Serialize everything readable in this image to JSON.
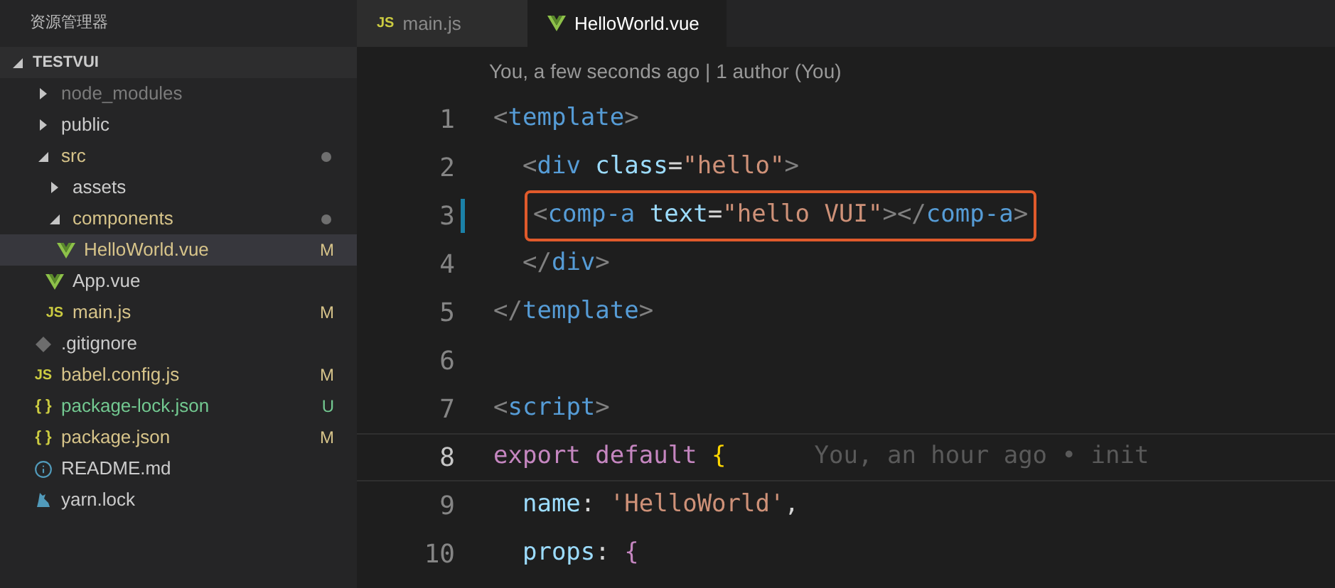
{
  "sidebar": {
    "title": "资源管理器",
    "section": {
      "label": "TESTVUI",
      "expanded": true
    },
    "tree": [
      {
        "name": "node_modules",
        "kind": "folder",
        "expanded": false,
        "color": "#7b7b7b",
        "dot": false,
        "selected": false
      },
      {
        "name": "public",
        "kind": "folder",
        "expanded": false,
        "color": "#cccccc",
        "dot": false,
        "selected": false
      },
      {
        "name": "src",
        "kind": "folder",
        "expanded": true,
        "color": "#d7c48a",
        "dot": true,
        "selected": false,
        "children": [
          {
            "name": "assets",
            "kind": "folder",
            "expanded": false,
            "color": "#cccccc",
            "dot": false,
            "selected": false
          },
          {
            "name": "components",
            "kind": "folder",
            "expanded": true,
            "color": "#d7c48a",
            "dot": true,
            "selected": false,
            "children": [
              {
                "name": "HelloWorld.vue",
                "kind": "vue",
                "color": "#d7c48a",
                "badge": "M",
                "dot": false,
                "selected": true
              }
            ]
          },
          {
            "name": "App.vue",
            "kind": "vue",
            "color": "#cccccc",
            "dot": false,
            "selected": false
          },
          {
            "name": "main.js",
            "kind": "js",
            "icon_label": "JS",
            "color": "#d7c48a",
            "badge": "M",
            "dot": false,
            "selected": false
          }
        ]
      },
      {
        "name": ".gitignore",
        "kind": "git",
        "color": "#cccccc",
        "dot": false,
        "selected": false
      },
      {
        "name": "babel.config.js",
        "kind": "js",
        "icon_label": "JS",
        "color": "#d7c48a",
        "badge": "M",
        "dot": false,
        "selected": false
      },
      {
        "name": "package-lock.json",
        "kind": "json",
        "icon_label": "{ }",
        "color": "#73c991",
        "badge": "U",
        "dot": false,
        "selected": false
      },
      {
        "name": "package.json",
        "kind": "json",
        "icon_label": "{ }",
        "color": "#d7c48a",
        "badge": "M",
        "dot": false,
        "selected": false
      },
      {
        "name": "README.md",
        "kind": "info",
        "color": "#cccccc",
        "dot": false,
        "selected": false
      },
      {
        "name": "yarn.lock",
        "kind": "yarn",
        "color": "#cccccc",
        "dot": false,
        "selected": false
      }
    ]
  },
  "tabs": [
    {
      "label": "main.js",
      "kind": "js",
      "icon_label": "JS",
      "selected": false
    },
    {
      "label": "HelloWorld.vue",
      "kind": "vue",
      "selected": true
    }
  ],
  "editor": {
    "codelens": "You, a few seconds ago | 1 author (You)",
    "lines": [
      {
        "number": "1",
        "active": false,
        "changed": false,
        "tokens": [
          {
            "kind": "punct",
            "text": "<"
          },
          {
            "kind": "tag",
            "text": "template"
          },
          {
            "kind": "punct",
            "text": ">"
          }
        ]
      },
      {
        "number": "2",
        "active": false,
        "changed": false,
        "tokens": [
          {
            "kind": "punct",
            "text": "  <"
          },
          {
            "kind": "tag",
            "text": "div"
          },
          {
            "kind": "attr",
            "text": " class"
          },
          {
            "kind": "plain",
            "text": "="
          },
          {
            "kind": "string",
            "text": "\"hello\""
          },
          {
            "kind": "punct",
            "text": ">"
          }
        ]
      },
      {
        "number": "3",
        "active": false,
        "changed": true,
        "boxed": true,
        "tokens": [
          {
            "kind": "punct",
            "text": "<"
          },
          {
            "kind": "tag",
            "text": "comp-a"
          },
          {
            "kind": "attr",
            "text": " text"
          },
          {
            "kind": "plain",
            "text": "="
          },
          {
            "kind": "string",
            "text": "\"hello VUI\""
          },
          {
            "kind": "punct",
            "text": "></"
          },
          {
            "kind": "tag",
            "text": "comp-a"
          },
          {
            "kind": "punct",
            "text": ">"
          }
        ]
      },
      {
        "number": "4",
        "active": false,
        "changed": false,
        "tokens": [
          {
            "kind": "punct",
            "text": "  </"
          },
          {
            "kind": "tag",
            "text": "div"
          },
          {
            "kind": "punct",
            "text": ">"
          }
        ]
      },
      {
        "number": "5",
        "active": false,
        "changed": false,
        "tokens": [
          {
            "kind": "punct",
            "text": "</"
          },
          {
            "kind": "tag",
            "text": "template"
          },
          {
            "kind": "punct",
            "text": ">"
          }
        ]
      },
      {
        "number": "6",
        "active": false,
        "changed": false
      },
      {
        "number": "7",
        "active": false,
        "changed": false,
        "tokens": [
          {
            "kind": "punct",
            "text": "<"
          },
          {
            "kind": "tag",
            "text": "script"
          },
          {
            "kind": "punct",
            "text": ">"
          }
        ]
      },
      {
        "number": "8",
        "active": true,
        "changed": false,
        "tokens": [
          {
            "kind": "keyword",
            "text": "export default"
          },
          {
            "kind": "brace",
            "text": " {"
          }
        ],
        "blame": "You, an hour ago • init"
      },
      {
        "number": "9",
        "active": false,
        "changed": false,
        "tokens": [
          {
            "kind": "prop",
            "text": "  name"
          },
          {
            "kind": "plain",
            "text": ": "
          },
          {
            "kind": "string",
            "text": "'HelloWorld'"
          },
          {
            "kind": "plain",
            "text": ","
          }
        ]
      },
      {
        "number": "10",
        "active": false,
        "changed": false,
        "tokens": [
          {
            "kind": "prop",
            "text": "  props"
          },
          {
            "kind": "plain",
            "text": ": "
          },
          {
            "kind": "keyword",
            "text": "{"
          }
        ]
      }
    ]
  }
}
